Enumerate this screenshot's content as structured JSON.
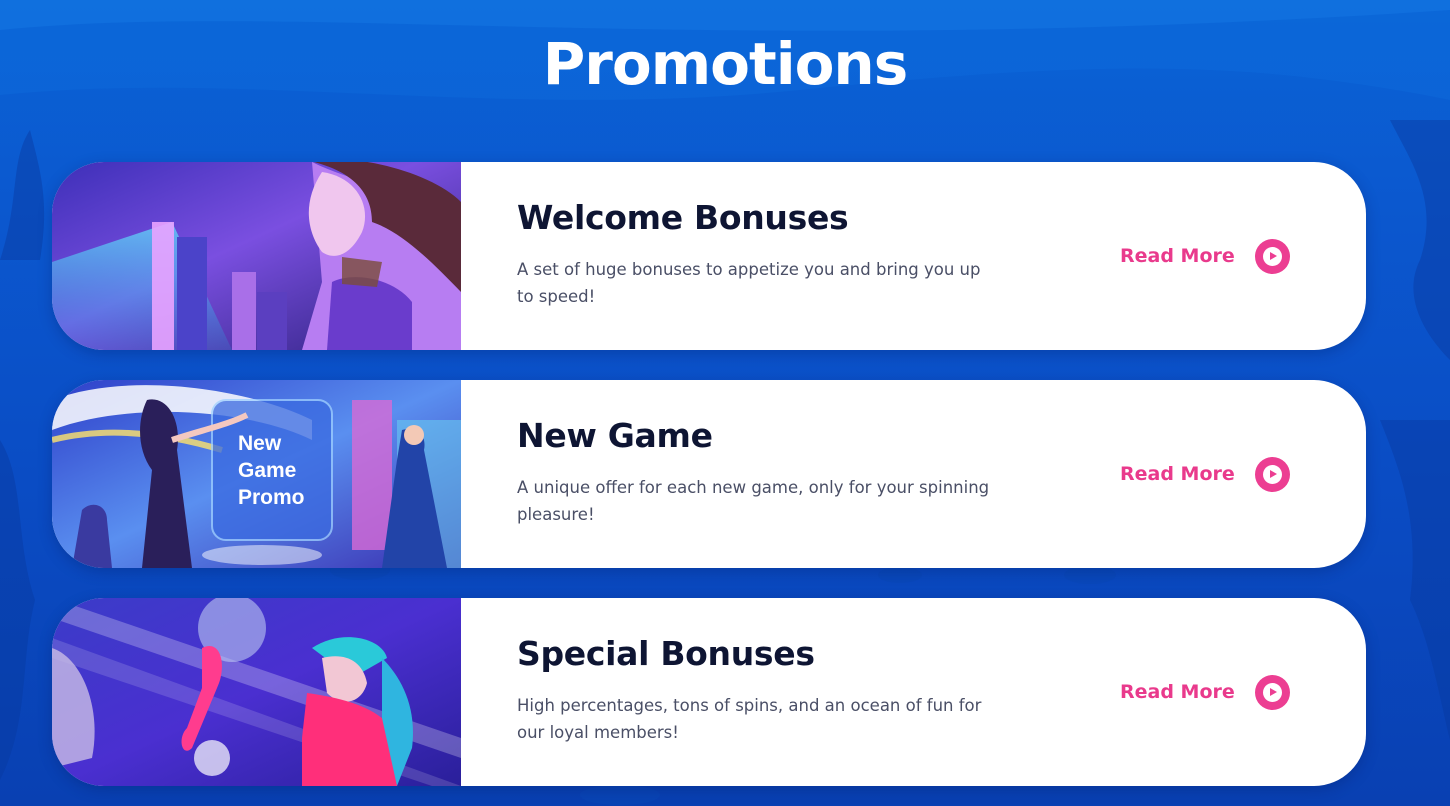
{
  "page": {
    "title": "Promotions"
  },
  "theme": {
    "background": "#0a58cf",
    "card_background": "#ffffff",
    "title_color": "#0e1533",
    "accent": "#ec3e92"
  },
  "promotions": [
    {
      "title": "Welcome Bonuses",
      "description": "A set of huge bonuses to appetize you and bring you up to speed!",
      "cta_label": "Read More",
      "cta_icon": "play-circle-icon",
      "image": "welcome-bonus-illustration"
    },
    {
      "title": "New Game",
      "description": "A unique offer for each new game, only for your spinning pleasure!",
      "cta_label": "Read More",
      "cta_icon": "play-circle-icon",
      "image": "new-game-promo-illustration",
      "image_text": [
        "New",
        "Game",
        "Promo"
      ]
    },
    {
      "title": "Special Bonuses",
      "description": "High percentages, tons of spins, and an ocean of fun for our loyal members!",
      "cta_label": "Read More",
      "cta_icon": "play-circle-icon",
      "image": "special-bonus-illustration"
    }
  ]
}
